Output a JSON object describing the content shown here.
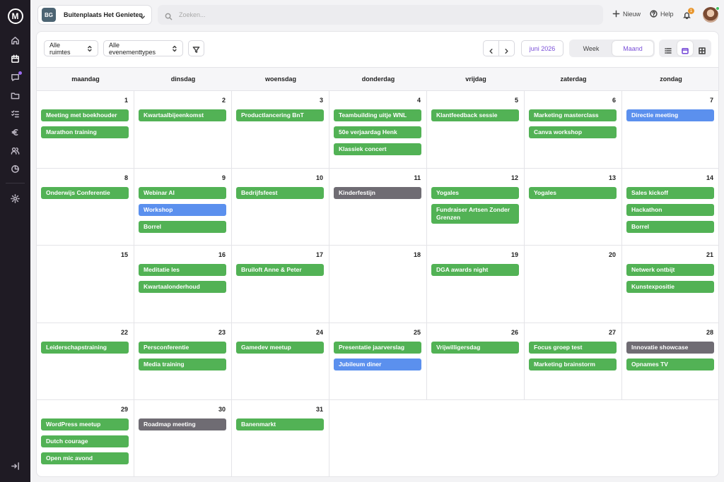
{
  "venue": {
    "badge": "BG",
    "name": "Buitenplaats Het Genieten"
  },
  "search": {
    "placeholder": "Zoeken..."
  },
  "top_actions": {
    "new_label": "Nieuw",
    "help_label": "Help",
    "notification_count": "1"
  },
  "filters": {
    "rooms": "Alle ruimtes",
    "event_types": "Alle evenementtypes"
  },
  "period": {
    "label": "juni 2026"
  },
  "view_toggle": {
    "week": "Week",
    "month": "Maand",
    "active": "month"
  },
  "colors": {
    "green": "#52b255",
    "blue": "#5b90ee",
    "gray": "#6f6c73",
    "accent": "#7a4fd8",
    "sidebar": "#1f1b24"
  },
  "weekdays": [
    "maandag",
    "dinsdag",
    "woensdag",
    "donderdag",
    "vrijdag",
    "zaterdag",
    "zondag"
  ],
  "days": [
    {
      "num": "1",
      "events": [
        {
          "title": "Meeting met boekhouder",
          "color": "green"
        },
        {
          "title": "Marathon training",
          "color": "green"
        }
      ]
    },
    {
      "num": "2",
      "events": [
        {
          "title": "Kwartaalbijeenkomst",
          "color": "green"
        }
      ]
    },
    {
      "num": "3",
      "events": [
        {
          "title": "Productlancering BnT",
          "color": "green"
        }
      ]
    },
    {
      "num": "4",
      "events": [
        {
          "title": "Teambuilding uitje WNL",
          "color": "green"
        },
        {
          "title": "50e verjaardag Henk",
          "color": "green"
        },
        {
          "title": "Klassiek concert",
          "color": "green"
        }
      ]
    },
    {
      "num": "5",
      "events": [
        {
          "title": "Klantfeedback sessie",
          "color": "green"
        }
      ]
    },
    {
      "num": "6",
      "events": [
        {
          "title": "Marketing masterclass",
          "color": "green"
        },
        {
          "title": "Canva workshop",
          "color": "green"
        }
      ]
    },
    {
      "num": "7",
      "events": [
        {
          "title": "Directie meeting",
          "color": "blue"
        }
      ]
    },
    {
      "num": "8",
      "events": [
        {
          "title": "Onderwijs Conferentie",
          "color": "green"
        }
      ]
    },
    {
      "num": "9",
      "events": [
        {
          "title": "Webinar AI",
          "color": "green"
        },
        {
          "title": "Workshop",
          "color": "blue"
        },
        {
          "title": "Borrel",
          "color": "green"
        }
      ]
    },
    {
      "num": "10",
      "events": [
        {
          "title": "Bedrijfsfeest",
          "color": "green"
        }
      ]
    },
    {
      "num": "11",
      "events": [
        {
          "title": "Kinderfestijn",
          "color": "gray"
        }
      ]
    },
    {
      "num": "12",
      "events": [
        {
          "title": "Yogales",
          "color": "green"
        },
        {
          "title": "Fundraiser Artsen Zonder Grenzen",
          "color": "green"
        }
      ]
    },
    {
      "num": "13",
      "events": [
        {
          "title": "Yogales",
          "color": "green"
        }
      ]
    },
    {
      "num": "14",
      "events": [
        {
          "title": "Sales kickoff",
          "color": "green"
        },
        {
          "title": "Hackathon",
          "color": "green"
        },
        {
          "title": "Borrel",
          "color": "green"
        }
      ]
    },
    {
      "num": "15",
      "events": []
    },
    {
      "num": "16",
      "events": [
        {
          "title": "Meditatie les",
          "color": "green"
        },
        {
          "title": "Kwartaalonderhoud",
          "color": "green"
        }
      ]
    },
    {
      "num": "17",
      "events": [
        {
          "title": "Bruiloft Anne & Peter",
          "color": "green"
        }
      ]
    },
    {
      "num": "18",
      "events": []
    },
    {
      "num": "19",
      "events": [
        {
          "title": "DGA awards night",
          "color": "green"
        }
      ]
    },
    {
      "num": "20",
      "events": []
    },
    {
      "num": "21",
      "events": [
        {
          "title": "Netwerk ontbijt",
          "color": "green"
        },
        {
          "title": "Kunstexpositie",
          "color": "green"
        }
      ]
    },
    {
      "num": "22",
      "events": [
        {
          "title": "Leiderschapstraining",
          "color": "green"
        }
      ]
    },
    {
      "num": "23",
      "events": [
        {
          "title": "Persconferentie",
          "color": "green"
        },
        {
          "title": "Media training",
          "color": "green"
        }
      ]
    },
    {
      "num": "24",
      "events": [
        {
          "title": "Gamedev meetup",
          "color": "green"
        }
      ]
    },
    {
      "num": "25",
      "events": [
        {
          "title": "Presentatie jaarverslag",
          "color": "green"
        },
        {
          "title": "Jubileum diner",
          "color": "blue"
        }
      ]
    },
    {
      "num": "26",
      "events": [
        {
          "title": "Vrijwilligersdag",
          "color": "green"
        }
      ]
    },
    {
      "num": "27",
      "events": [
        {
          "title": "Focus groep test",
          "color": "green"
        },
        {
          "title": "Marketing brainstorm",
          "color": "green"
        }
      ]
    },
    {
      "num": "28",
      "events": [
        {
          "title": "Innovatie showcase",
          "color": "gray"
        },
        {
          "title": "Opnames TV",
          "color": "green"
        }
      ]
    },
    {
      "num": "29",
      "events": [
        {
          "title": "WordPress meetup",
          "color": "green"
        },
        {
          "title": "Dutch courage",
          "color": "green"
        },
        {
          "title": "Open mic avond",
          "color": "green"
        }
      ]
    },
    {
      "num": "30",
      "events": [
        {
          "title": "Roadmap meeting",
          "color": "gray"
        }
      ]
    },
    {
      "num": "31",
      "events": [
        {
          "title": "Banenmarkt",
          "color": "green"
        }
      ]
    }
  ]
}
